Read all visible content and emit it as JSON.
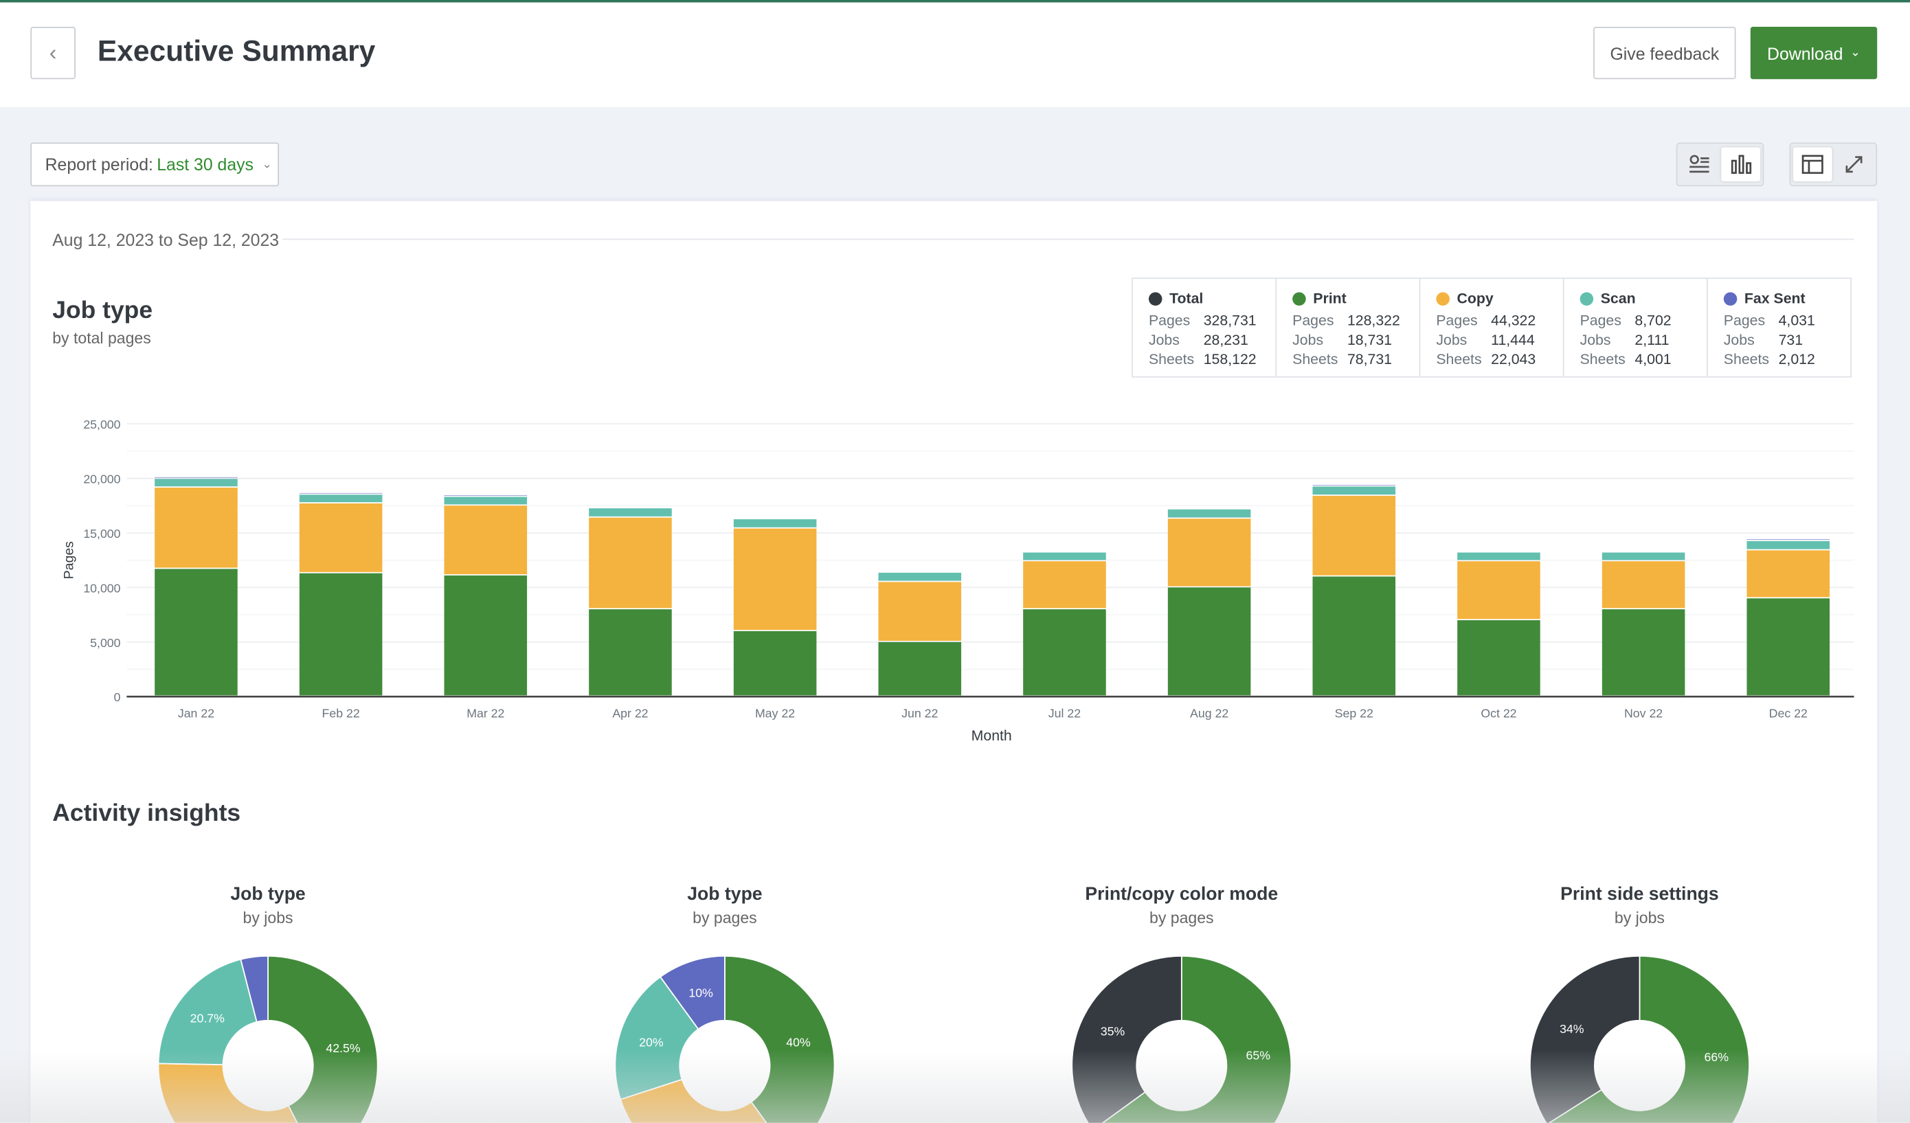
{
  "header": {
    "title": "Executive Summary",
    "feedback_label": "Give feedback",
    "download_label": "Download"
  },
  "toolbar": {
    "period_label": "Report period:",
    "period_value": "Last 30 days"
  },
  "report": {
    "date_range": "Aug 12, 2023 to Sep 12, 2023",
    "title": "Job type",
    "subtitle": "by total pages"
  },
  "legend": [
    {
      "name": "Total",
      "color": "#343a40",
      "pages": "328,731",
      "jobs": "28,231",
      "sheets": "158,122"
    },
    {
      "name": "Print",
      "color": "#418a3a",
      "pages": "128,322",
      "jobs": "18,731",
      "sheets": "78,731"
    },
    {
      "name": "Copy",
      "color": "#f4b23e",
      "pages": "44,322",
      "jobs": "11,444",
      "sheets": "22,043"
    },
    {
      "name": "Scan",
      "color": "#62bfae",
      "pages": "8,702",
      "jobs": "2,111",
      "sheets": "4,001"
    },
    {
      "name": "Fax Sent",
      "color": "#5f6bc0",
      "pages": "4,031",
      "jobs": "731",
      "sheets": "2,012"
    }
  ],
  "legend_labels": {
    "pages": "Pages",
    "jobs": "Jobs",
    "sheets": "Sheets"
  },
  "chart_data": [
    {
      "type": "bar",
      "stacked": true,
      "xlabel": "Month",
      "ylabel": "Pages",
      "ylim": [
        0,
        25000
      ],
      "yticks": [
        "0",
        "5,000",
        "10,000",
        "15,000",
        "20,000",
        "25,000"
      ],
      "grid": true,
      "categories": [
        "Jan 22",
        "Feb 22",
        "Mar 22",
        "Apr 22",
        "May 22",
        "Jun 22",
        "Jul 22",
        "Aug 22",
        "Sep 22",
        "Oct 22",
        "Nov 22",
        "Dec 22"
      ],
      "series": [
        {
          "name": "Print",
          "color": "#418a3a",
          "values": [
            11700,
            11300,
            11100,
            8000,
            6000,
            5000,
            8000,
            10000,
            11000,
            7000,
            8000,
            9000
          ]
        },
        {
          "name": "Copy",
          "color": "#f4b23e",
          "values": [
            7450,
            6400,
            6400,
            8400,
            9400,
            5500,
            4400,
            6300,
            7400,
            5400,
            4400,
            4400
          ]
        },
        {
          "name": "Scan",
          "color": "#62bfae",
          "values": [
            800,
            800,
            800,
            850,
            850,
            850,
            800,
            850,
            850,
            800,
            800,
            850
          ]
        },
        {
          "name": "Fax Sent",
          "color": "#5f6bc0",
          "values": [
            150,
            150,
            150,
            100,
            100,
            50,
            100,
            100,
            150,
            100,
            100,
            150
          ]
        }
      ]
    },
    {
      "type": "pie",
      "title": "Job type",
      "subtitle": "by jobs",
      "slices": [
        {
          "name": "Print",
          "value": 42.5,
          "label": "42.5%",
          "color": "#418a3a"
        },
        {
          "name": "Copy",
          "value": 32.8,
          "label": "",
          "color": "#f4b23e"
        },
        {
          "name": "Scan",
          "value": 20.7,
          "label": "20.7%",
          "color": "#62bfae"
        },
        {
          "name": "Fax Sent",
          "value": 4,
          "label": "",
          "color": "#5f6bc0"
        }
      ]
    },
    {
      "type": "pie",
      "title": "Job type",
      "subtitle": "by pages",
      "slices": [
        {
          "name": "Print",
          "value": 40,
          "label": "40%",
          "color": "#418a3a"
        },
        {
          "name": "Copy",
          "value": 30,
          "label": "",
          "color": "#f4b23e"
        },
        {
          "name": "Scan",
          "value": 20,
          "label": "20%",
          "color": "#62bfae"
        },
        {
          "name": "Fax Sent",
          "value": 10,
          "label": "10%",
          "color": "#5f6bc0"
        }
      ]
    },
    {
      "type": "pie",
      "title": "Print/copy color mode",
      "subtitle": "by pages",
      "slices": [
        {
          "value": 65,
          "label": "65%",
          "color": "#418a3a"
        },
        {
          "value": 35,
          "label": "35%",
          "color": "#343a40"
        }
      ]
    },
    {
      "type": "pie",
      "title": "Print side settings",
      "subtitle": "by jobs",
      "slices": [
        {
          "value": 66,
          "label": "66%",
          "color": "#418a3a"
        },
        {
          "value": 34,
          "label": "34%",
          "color": "#343a40"
        }
      ]
    }
  ],
  "insights": {
    "title": "Activity insights"
  },
  "icons": {
    "back": "chevron-left-icon",
    "download_caret": "chevron-down-icon",
    "list_view": "list-view-icon",
    "chart_view": "bar-chart-icon",
    "layout": "layout-icon",
    "expand": "expand-icon"
  }
}
